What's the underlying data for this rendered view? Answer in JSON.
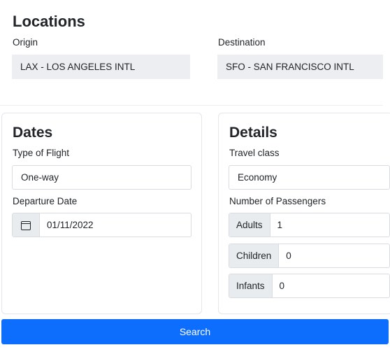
{
  "locations": {
    "title": "Locations",
    "origin_label": "Origin",
    "origin_value": "LAX - LOS ANGELES INTL",
    "destination_label": "Destination",
    "destination_value": "SFO - SAN FRANCISCO INTL"
  },
  "dates": {
    "title": "Dates",
    "flight_type_label": "Type of Flight",
    "flight_type_value": "One-way",
    "departure_label": "Departure Date",
    "departure_icon": "calendar-icon",
    "departure_value": "01/11/2022"
  },
  "details": {
    "title": "Details",
    "travel_class_label": "Travel class",
    "travel_class_value": "Economy",
    "passengers_label": "Number of Passengers",
    "adults_label": "Adults",
    "adults_value": "1",
    "children_label": "Children",
    "children_value": "0",
    "infants_label": "Infants",
    "infants_value": "0"
  },
  "actions": {
    "search_label": "Search"
  },
  "colors": {
    "primary": "#0d6efd",
    "readonly_bg": "#eceef1",
    "addon_bg": "#e9ecef"
  }
}
